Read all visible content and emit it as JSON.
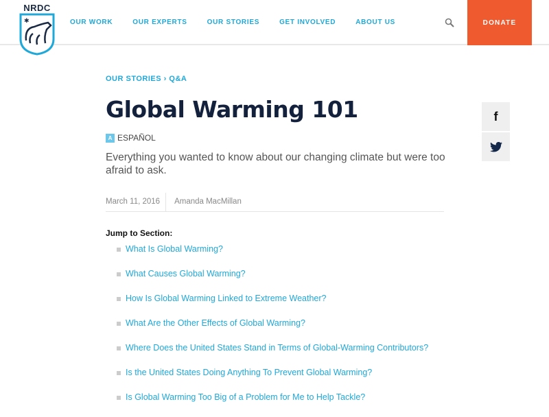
{
  "header": {
    "logo_text": "NRDC",
    "nav": [
      "OUR WORK",
      "OUR EXPERTS",
      "OUR STORIES",
      "GET INVOLVED",
      "ABOUT US"
    ],
    "donate": "DONATE"
  },
  "article": {
    "breadcrumb": [
      "OUR STORIES",
      "Q&A"
    ],
    "breadcrumb_sep": "›",
    "title": "Global Warming 101",
    "language": "ESPAÑOL",
    "language_icon_letter": "A",
    "dek": "Everything you wanted to know about our changing climate but were too afraid to ask.",
    "date": "March 11, 2016",
    "author": "Amanda MacMillan"
  },
  "jump": {
    "label": "Jump to Section:",
    "items": [
      "What Is Global Warming?",
      "What Causes Global Warming?",
      "How Is Global Warming Linked to Extreme Weather?",
      "What Are the Other Effects of Global Warming?",
      "Where Does the United States Stand in Terms of Global-Warming Contributors?",
      "Is the United States Doing Anything To Prevent Global Warming?",
      "Is Global Warming Too Big of a Problem for Me to Help Tackle?"
    ]
  },
  "social": {
    "facebook": "f"
  },
  "colors": {
    "accent": "#20a8d8",
    "donate": "#ef5a2f",
    "title": "#14213d"
  }
}
